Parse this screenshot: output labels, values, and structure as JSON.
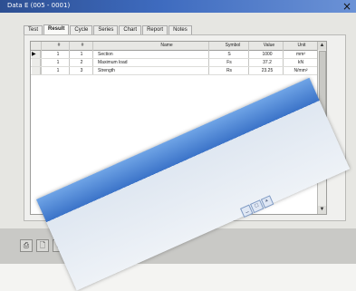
{
  "window": {
    "title": "Data E (005 - 0001)",
    "close_glyph": "×"
  },
  "tabs": [
    "Test",
    "Result",
    "Cycle",
    "Series",
    "Chart",
    "Report",
    "Notes"
  ],
  "table": {
    "columns": [
      "#",
      "#",
      "Name",
      "Symbol",
      "Value",
      "Unit"
    ],
    "rows": [
      {
        "a": "1",
        "b": "1",
        "name": "Section",
        "symbol": "S",
        "value": "1000",
        "unit": "mm²"
      },
      {
        "a": "1",
        "b": "2",
        "name": "Maximum load",
        "symbol": "Fs",
        "value": "37.2",
        "unit": "kN"
      },
      {
        "a": "1",
        "b": "3",
        "name": "Strength",
        "symbol": "Rs",
        "value": "23.25",
        "unit": "N/mm²"
      }
    ],
    "current_row_marker": "▶"
  },
  "toolbar": {
    "buttons": [
      "print-icon",
      "preview-icon",
      "export-icon"
    ],
    "glyphs": [
      "⎙",
      "🗋",
      "⌂"
    ]
  },
  "overlay_window": {
    "buttons": [
      "_",
      "□",
      "×"
    ]
  },
  "colors": {
    "titlebar": "#2d4f92",
    "overlay_titlebar": "#3b73c8"
  }
}
